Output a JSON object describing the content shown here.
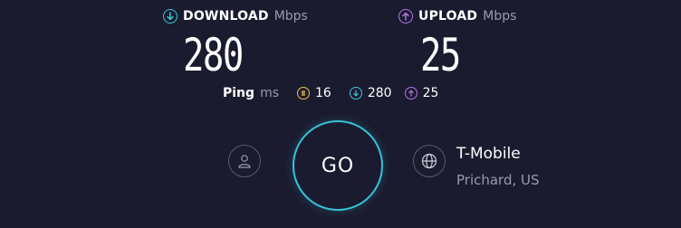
{
  "download": {
    "label": "DOWNLOAD",
    "unit": "Mbps",
    "value": "280",
    "color": "#3ec6d6",
    "icon": "arrow-down-circle-icon"
  },
  "upload": {
    "label": "UPLOAD",
    "unit": "Mbps",
    "value": "25",
    "color": "#b176e8",
    "icon": "arrow-up-circle-icon"
  },
  "ping": {
    "label": "Ping",
    "unit": "ms",
    "latency": "16",
    "latency_color": "#f2c14e",
    "download": "280",
    "upload": "25"
  },
  "go_button": {
    "label": "GO",
    "accent": "#35c2d8"
  },
  "provider": {
    "name": "T-Mobile",
    "location": "Prichard, US",
    "icon": "globe-icon"
  },
  "user": {
    "icon": "user-icon"
  }
}
